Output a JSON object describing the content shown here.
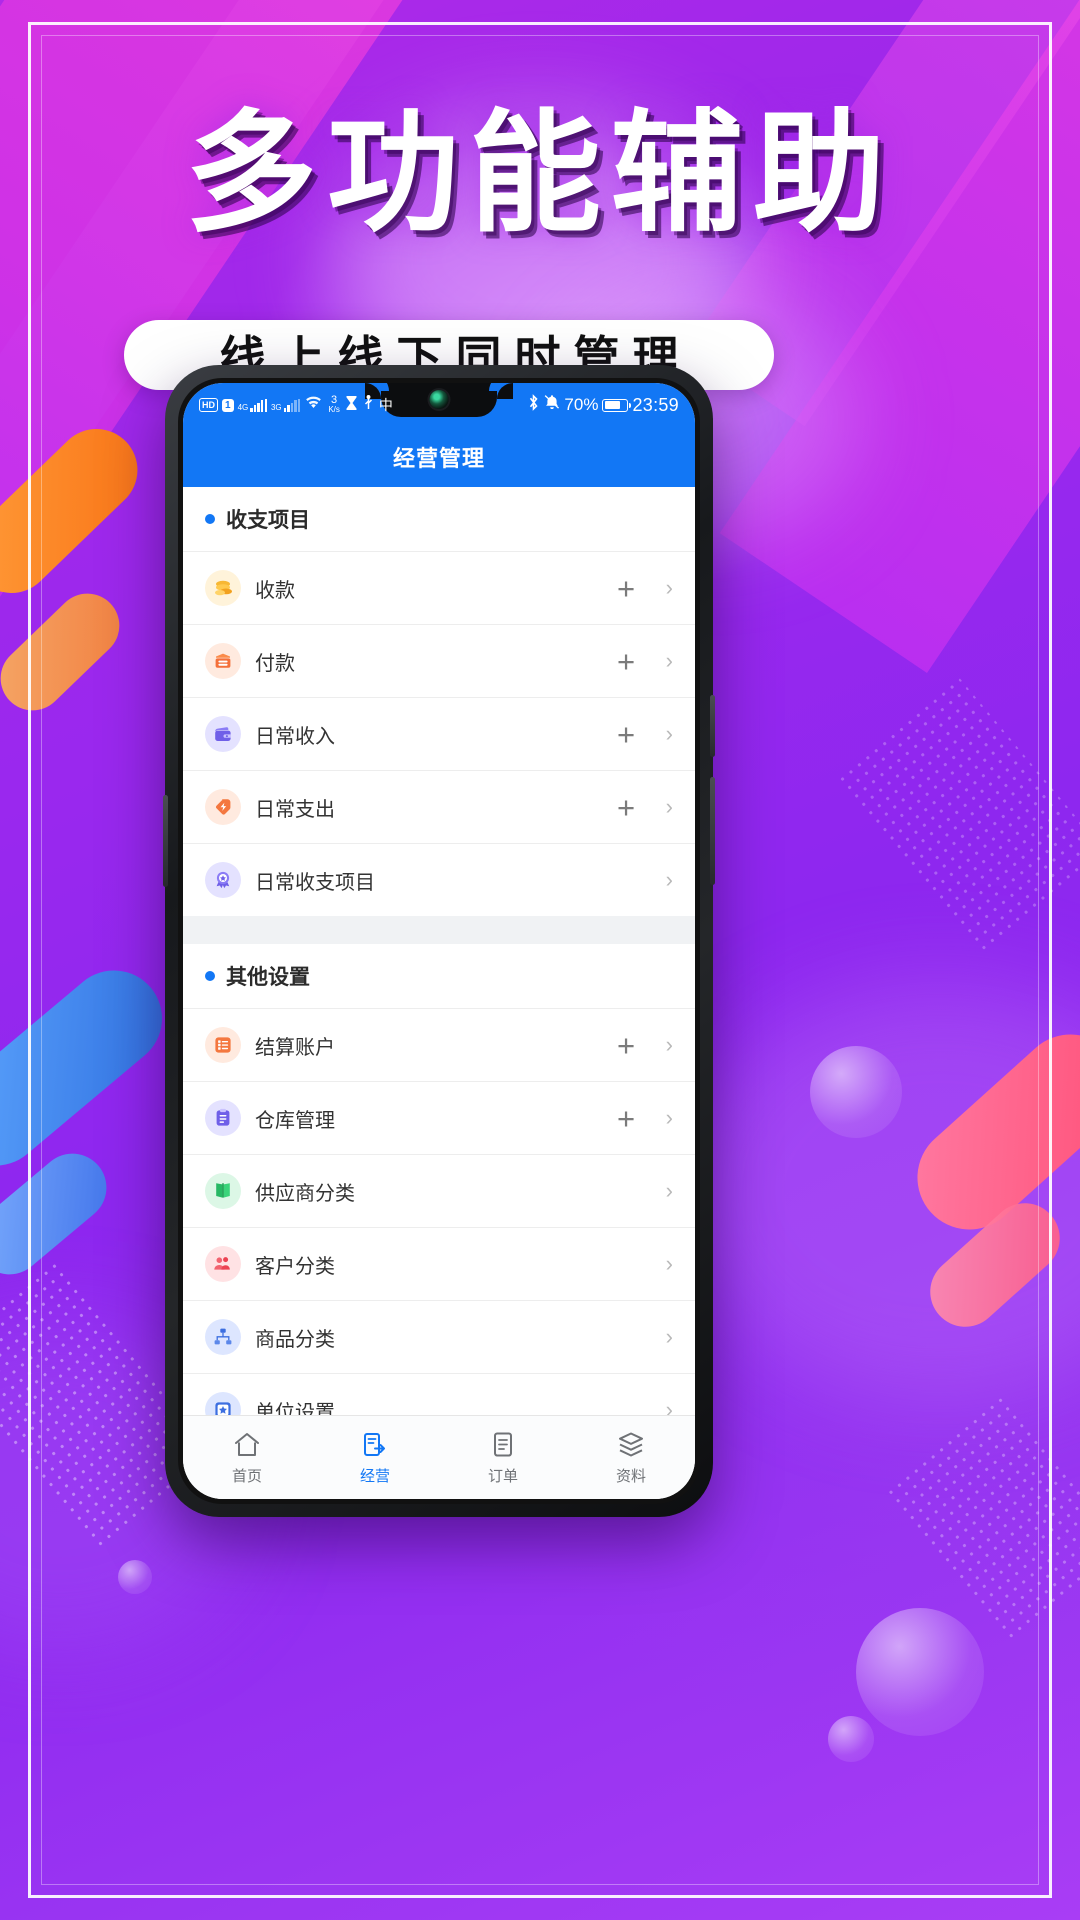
{
  "promo": {
    "headline": "多功能辅助",
    "subtitle": "线上线下同时管理",
    "accent_purple": "#9a28ee",
    "accent_magenta": "#e23bdc",
    "pill_bg": "#ffffff"
  },
  "status_bar": {
    "hd_label": "HD",
    "sim_label": "1",
    "net1_label": "4G",
    "net2_label": "3G",
    "speed_value": "3",
    "speed_unit": "K/s",
    "input_method": "中",
    "battery_percent": "70%",
    "clock": "23:59",
    "bg_color": "#1277f5"
  },
  "app_bar": {
    "title": "经营管理",
    "bg_color": "#1277f5"
  },
  "sections": [
    {
      "title": "收支项目",
      "rows": [
        {
          "label": "收款",
          "icon": "coins-icon",
          "has_plus": true,
          "chevron": "›"
        },
        {
          "label": "付款",
          "icon": "cashbox-icon",
          "has_plus": true,
          "chevron": "›"
        },
        {
          "label": "日常收入",
          "icon": "wallet-icon",
          "has_plus": true,
          "chevron": "›"
        },
        {
          "label": "日常支出",
          "icon": "tag-bolt-icon",
          "has_plus": true,
          "chevron": "›"
        },
        {
          "label": "日常收支项目",
          "icon": "medal-icon",
          "has_plus": false,
          "chevron": "›"
        }
      ]
    },
    {
      "title": "其他设置",
      "rows": [
        {
          "label": "结算账户",
          "icon": "list-icon",
          "has_plus": true,
          "chevron": "›"
        },
        {
          "label": "仓库管理",
          "icon": "clipboard-icon",
          "has_plus": true,
          "chevron": "›"
        },
        {
          "label": "供应商分类",
          "icon": "book-icon",
          "has_plus": false,
          "chevron": "›"
        },
        {
          "label": "客户分类",
          "icon": "users-icon",
          "has_plus": false,
          "chevron": "›"
        },
        {
          "label": "商品分类",
          "icon": "sitemap-icon",
          "has_plus": false,
          "chevron": "›"
        },
        {
          "label": "单位设置",
          "icon": "star-badge-icon",
          "has_plus": false,
          "chevron": "›"
        }
      ]
    }
  ],
  "plus_symbol": "+",
  "bottom_nav": {
    "active_color": "#1277f5",
    "items": [
      {
        "label": "首页",
        "icon": "home-icon",
        "active": false
      },
      {
        "label": "经营",
        "icon": "business-icon",
        "active": true
      },
      {
        "label": "订单",
        "icon": "order-icon",
        "active": false
      },
      {
        "label": "资料",
        "icon": "layers-icon",
        "active": false
      }
    ]
  }
}
